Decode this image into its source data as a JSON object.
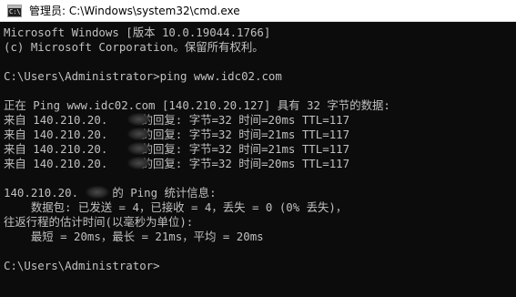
{
  "window": {
    "title": "管理员: C:\\Windows\\system32\\cmd.exe",
    "icon_name": "cmd-console-icon",
    "icon_text": "C:\\"
  },
  "colors": {
    "console_background": "#0c0c0c",
    "console_text": "#c0c0c0",
    "titlebar_background": "#ffffff"
  },
  "console": {
    "lines": [
      "Microsoft Windows [版本 10.0.19044.1766]",
      "(c) Microsoft Corporation。保留所有权利。",
      "",
      "C:\\Users\\Administrator>ping www.idc02.com",
      "",
      "正在 Ping www.idc02.com [140.210.20.127] 具有 32 字节的数据:",
      "来自 140.210.20.     的回复: 字节=32 时间=20ms TTL=117",
      "来自 140.210.20.     的回复: 字节=32 时间=21ms TTL=117",
      "来自 140.210.20.     的回复: 字节=32 时间=21ms TTL=117",
      "来自 140.210.20.     的回复: 字节=32 时间=20ms TTL=117",
      "",
      "140.210.20.     的 Ping 统计信息:",
      "    数据包: 已发送 = 4，已接收 = 4，丢失 = 0 (0% 丢失)，",
      "往返行程的估计时间(以毫秒为单位):",
      "    最短 = 20ms，最长 = 21ms，平均 = 20ms",
      "",
      "C:\\Users\\Administrator>"
    ]
  }
}
